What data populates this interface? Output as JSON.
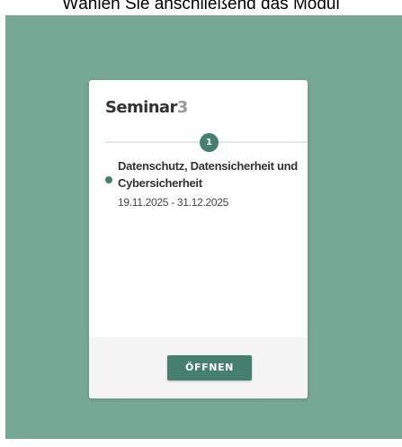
{
  "instruction_text": "Wählen Sie anschließend das Modul",
  "card": {
    "title": "Seminar",
    "title_number": "3",
    "current_step": "1",
    "module": {
      "title": "Datenschutz, Datensicherheit und Cybersicherheit",
      "dates": "19.11.2025 - 31.12.2025",
      "status_color": "#44806d"
    },
    "open_button_label": "ÖFFNEN"
  },
  "colors": {
    "backdrop": "#76a896",
    "accent": "#44806d",
    "card_background": "#ffffff",
    "footer_background": "#f4f4f4"
  }
}
